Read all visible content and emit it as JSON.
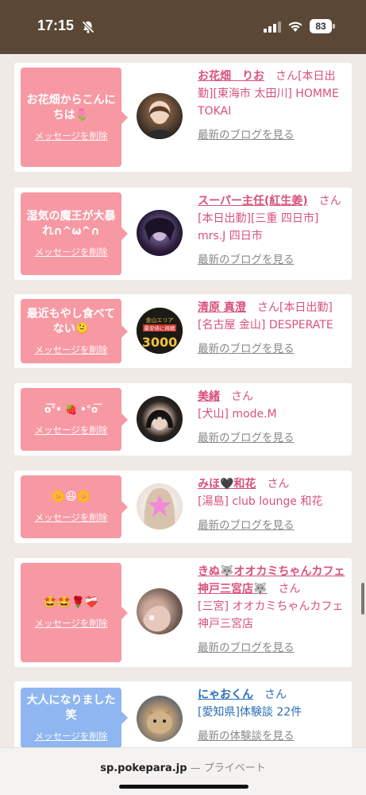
{
  "status": {
    "time": "17:15",
    "battery": "83"
  },
  "url": {
    "domain": "sp.pokepara.jp",
    "separator": " — ",
    "mode": "プライベート"
  },
  "cards": [
    {
      "message": "お花畑からこんにちは🌷",
      "delete": "メッセージを削除",
      "name": "お花畑　りお",
      "san": "さん",
      "detail": "[本日出勤][東海市 太田川] HOMME TOKAI",
      "blog": "最新のブログを見る"
    },
    {
      "message": "湿気の魔王が大暴れ∩^ω^∩",
      "delete": "メッセージを削除",
      "name": "スーパー主任(紅生姜)",
      "san": "さん",
      "detail": "[本日出勤][三重 四日市] mrs.J 四日市",
      "blog": "最新のブログを見る"
    },
    {
      "message": "最近もやし食べてない🫠",
      "delete": "メッセージを削除",
      "name": "清原 真澄",
      "san": "さん",
      "detail": "[本日出勤][名古屋 金山] DESPERATE",
      "blog": "最新のブログを見る"
    },
    {
      "message": "o͞͞°• 🍓 •°o͞",
      "delete": "メッセージを削除",
      "name": "美緒",
      "san": "さん",
      "detail": "[犬山] mode.M",
      "blog": "最新のブログを見る"
    },
    {
      "message": "🌼😆🌼",
      "delete": "メッセージを削除",
      "name": "みほ🖤和花",
      "san": "さん",
      "detail": "[湯島] club lounge 和花",
      "blog": "最新のブログを見る"
    },
    {
      "message": "🤩🤩🌹❤️‍🩹",
      "delete": "メッセージを削除",
      "name": "きぬ🐺オオカミちゃんカフェ神戸三宮店🐺",
      "san": "さん",
      "detail": "[三宮] オオカミちゃんカフェ神戸三宮店",
      "blog": "最新のブログを見る"
    },
    {
      "message": "大人になりました笑",
      "delete": "メッセージを削除",
      "name": "にゃおくん",
      "san": "さん",
      "detail": "[愛知県]体験談 22件",
      "blog": "最新の体験談を見る"
    }
  ]
}
